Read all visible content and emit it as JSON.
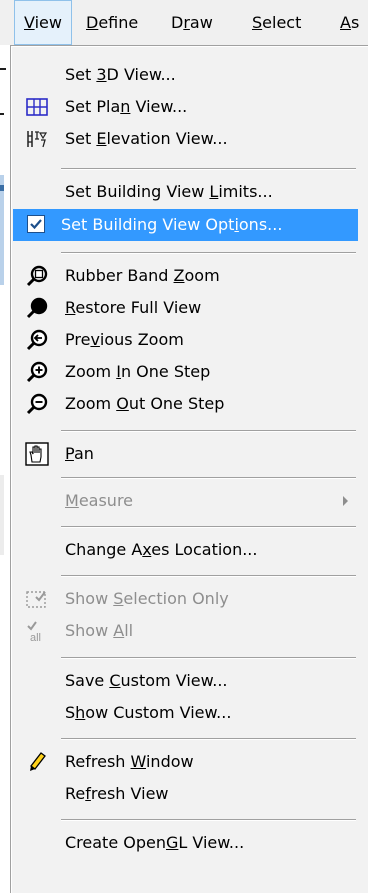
{
  "menubar": {
    "items": [
      {
        "label": "View",
        "mnemonic": "V"
      },
      {
        "label": "Define",
        "mnemonic": "D"
      },
      {
        "label": "Draw",
        "mnemonic": "r"
      },
      {
        "label": "Select",
        "mnemonic": "S"
      },
      {
        "label": "As",
        "mnemonic": "A"
      }
    ]
  },
  "view_menu": {
    "items": [
      {
        "label": "Set 3D View...",
        "icon": "none"
      },
      {
        "label": "Set Plan View...",
        "icon": "plan-grid-icon"
      },
      {
        "label": "Set Elevation View...",
        "icon": "elevation-icon"
      },
      {
        "label": "Set Building View Limits...",
        "icon": "none"
      },
      {
        "label": "Set Building View Options...",
        "icon": "checkbox-checked-icon",
        "highlighted": true
      },
      {
        "label": "Rubber Band Zoom",
        "icon": "rubber-band-zoom-icon"
      },
      {
        "label": "Restore Full View",
        "icon": "restore-full-view-icon"
      },
      {
        "label": "Previous Zoom",
        "icon": "previous-zoom-icon"
      },
      {
        "label": "Zoom In One Step",
        "icon": "zoom-in-icon"
      },
      {
        "label": "Zoom Out One Step",
        "icon": "zoom-out-icon"
      },
      {
        "label": "Pan",
        "icon": "pan-hand-icon"
      },
      {
        "label": "Measure",
        "icon": "none",
        "disabled": true,
        "submenu": true
      },
      {
        "label": "Change Axes Location...",
        "icon": "none"
      },
      {
        "label": "Show Selection Only",
        "icon": "show-selection-icon",
        "disabled": true
      },
      {
        "label": "Show All",
        "icon": "show-all-icon",
        "disabled": true
      },
      {
        "label": "Save Custom View...",
        "icon": "none"
      },
      {
        "label": "Show Custom View...",
        "icon": "none"
      },
      {
        "label": "Refresh Window",
        "icon": "pencil-icon"
      },
      {
        "label": "Refresh View",
        "icon": "none"
      },
      {
        "label": "Create OpenGL View...",
        "icon": "none"
      }
    ]
  },
  "colors": {
    "menu_bg": "#f2f2f2",
    "highlight": "#3399ff",
    "disabled_text": "#8e8e8e",
    "separator": "#a0a0a0"
  }
}
